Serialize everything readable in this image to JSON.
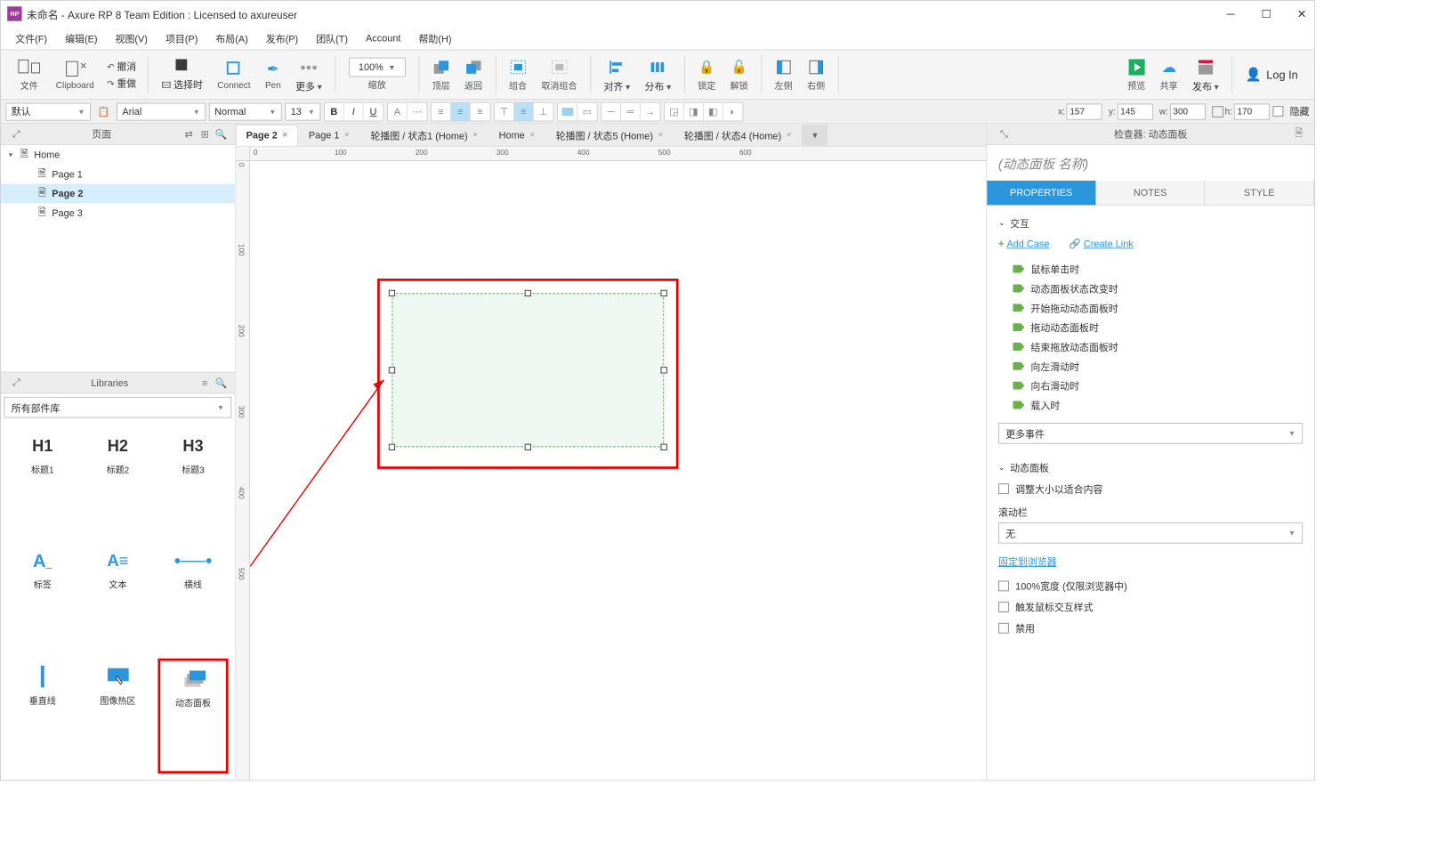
{
  "window": {
    "title": "未命名 - Axure RP 8 Team Edition : Licensed to axureuser"
  },
  "menu": [
    "文件(F)",
    "编辑(E)",
    "视图(V)",
    "项目(P)",
    "布局(A)",
    "发布(P)",
    "团队(T)",
    "Account",
    "帮助(H)"
  ],
  "toolbar": {
    "file": "文件",
    "clipboard": "Clipboard",
    "undo": "撤消",
    "redo": "重做",
    "select": "选择时",
    "connect": "Connect",
    "pen": "Pen",
    "more": "更多",
    "zoom": "100%",
    "zoomLabel": "缩放",
    "front": "顶层",
    "back": "返回",
    "group": "组合",
    "ungroup": "取消组合",
    "align": "对齐",
    "distribute": "分布",
    "lock": "锁定",
    "unlock": "解锁",
    "left": "左侧",
    "right": "右侧",
    "preview": "预览",
    "share": "共享",
    "publish": "发布",
    "login": "Log In"
  },
  "style": {
    "styleset": "默认",
    "font": "Arial",
    "weight": "Normal",
    "size": "13",
    "x": "157",
    "y": "145",
    "w": "300",
    "h": "170",
    "hideLabel": "隐藏"
  },
  "pagesPanel": {
    "title": "页面"
  },
  "pages": [
    {
      "label": "Home",
      "depth": 0,
      "expanded": true,
      "sel": false
    },
    {
      "label": "Page 1",
      "depth": 1,
      "sel": false
    },
    {
      "label": "Page 2",
      "depth": 1,
      "sel": true
    },
    {
      "label": "Page 3",
      "depth": 1,
      "sel": false
    }
  ],
  "libPanel": {
    "title": "Libraries",
    "selector": "所有部件库"
  },
  "widgets": [
    {
      "icon": "H1",
      "label": "标题1"
    },
    {
      "icon": "H2",
      "label": "标题2"
    },
    {
      "icon": "H3",
      "label": "标题3"
    },
    {
      "icon": "A_",
      "label": "标签"
    },
    {
      "icon": "A≡",
      "label": "文本"
    },
    {
      "icon": "—",
      "label": "横线"
    },
    {
      "icon": "|",
      "label": "垂直线"
    },
    {
      "icon": "hot",
      "label": "图像热区"
    },
    {
      "icon": "dyn",
      "label": "动态面板"
    }
  ],
  "tabs": [
    {
      "label": "Page 2",
      "active": true
    },
    {
      "label": "Page 1",
      "active": false
    },
    {
      "label": "轮播图 / 状态1 (Home)",
      "active": false
    },
    {
      "label": "Home",
      "active": false
    },
    {
      "label": "轮播图 / 状态5 (Home)",
      "active": false
    },
    {
      "label": "轮播图 / 状态4 (Home)",
      "active": false
    }
  ],
  "rulerH": [
    0,
    100,
    200,
    300,
    400,
    500,
    600
  ],
  "rulerV": [
    0,
    100,
    200,
    300,
    400,
    500
  ],
  "inspector": {
    "header": "检查器: 动态面板",
    "name": "(动态面板 名称)",
    "tabs": {
      "props": "PROPERTIES",
      "notes": "NOTES",
      "style": "STYLE"
    },
    "interaction": "交互",
    "addCase": "Add Case",
    "createLink": "Create Link",
    "events": [
      "鼠标单击时",
      "动态面板状态改变时",
      "开始拖动动态面板时",
      "拖动动态面板时",
      "结束拖放动态面板时",
      "向左滑动时",
      "向右滑动时",
      "载入时"
    ],
    "moreEvents": "更多事件",
    "panelSection": "动态面板",
    "fitContent": "调整大小以适合内容",
    "scrollLabel": "滚动栏",
    "scrollValue": "无",
    "pinBrowser": "固定到浏览器",
    "fullWidth": "100%宽度 (仅限浏览器中)",
    "triggerMouse": "触发鼠标交互样式",
    "disable": "禁用"
  }
}
